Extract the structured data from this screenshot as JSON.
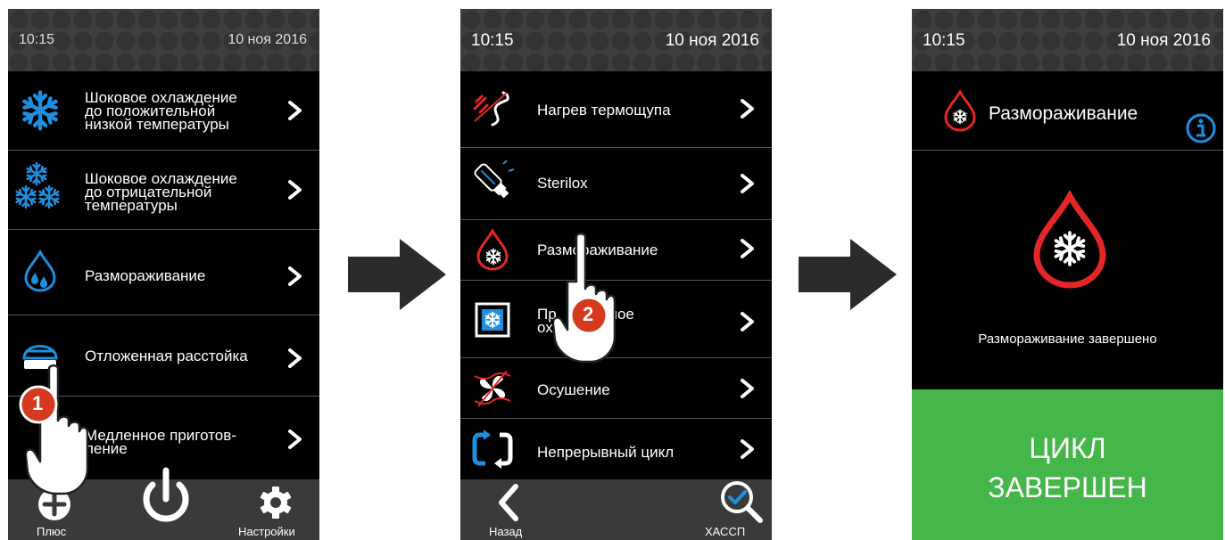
{
  "colors": {
    "accent_blue": "#1e8fe0",
    "accent_red": "#e32626",
    "status_green": "#45b649"
  },
  "screen1": {
    "time": "10:15",
    "date": "10 ноя 2016",
    "items": [
      {
        "icon": "snowflake-icon",
        "lines": [
          "Шоковое охлаждение",
          "до положительной",
          "низкой температуры"
        ]
      },
      {
        "icon": "multi-snowflake-icon",
        "lines": [
          "Шоковое охлаждение",
          "до отрицательной",
          "температуры"
        ]
      },
      {
        "icon": "water-drop-icon",
        "lines": [
          "Размораживание"
        ]
      },
      {
        "icon": "dough-proofing-icon",
        "lines": [
          "Отложенная расстойка"
        ]
      },
      {
        "icon": "slow-cook-icon",
        "lines": [
          "Медленное приготов-",
          "ление"
        ]
      }
    ],
    "bottom": {
      "plus_label": "Плюс",
      "settings_label": "Настройки"
    },
    "step_badge": "1"
  },
  "screen2": {
    "time": "10:15",
    "date": "10 ноя 2016",
    "items": [
      {
        "icon": "probe-heat-icon",
        "lines": [
          "Нагрев термощупа"
        ]
      },
      {
        "icon": "uv-lamp-icon",
        "lines": [
          "Sterilox"
        ]
      },
      {
        "icon": "defrost-drop-icon",
        "lines": [
          "Размораживание"
        ]
      },
      {
        "icon": "chill-box-icon",
        "lines": [
          "Пр     тельное",
          "ох       ие"
        ]
      },
      {
        "icon": "drying-fan-icon",
        "lines": [
          "Осушение"
        ]
      },
      {
        "icon": "cycle-icon",
        "lines": [
          "Непрерывный цикл"
        ]
      }
    ],
    "bottom": {
      "back_label": "Назад",
      "haccp_label": "ХАССП"
    },
    "step_badge": "2"
  },
  "screen3": {
    "time": "10:15",
    "date": "10 ноя 2016",
    "title": "Размораживание",
    "status": "Размораживание завершено",
    "banner_line1": "ЦИКЛ",
    "banner_line2": "ЗАВЕРШЕН"
  }
}
